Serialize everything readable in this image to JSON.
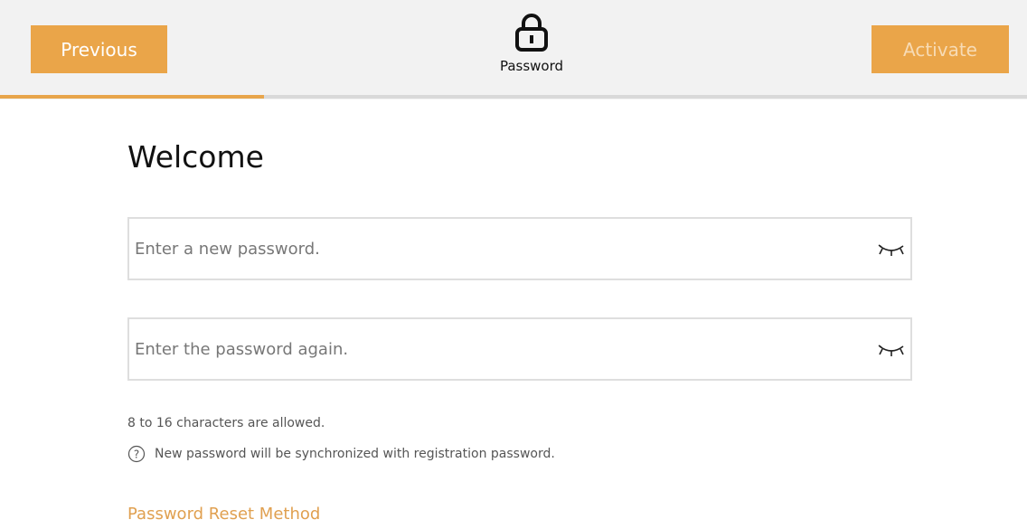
{
  "header": {
    "previous_label": "Previous",
    "activate_label": "Activate",
    "step_label": "Password",
    "step_icon": "lock-icon",
    "progress_fraction": 0.257
  },
  "main": {
    "title": "Welcome",
    "new_password": {
      "value": "",
      "placeholder": "Enter a new password.",
      "toggle_icon": "eye-closed-icon"
    },
    "confirm_password": {
      "value": "",
      "placeholder": "Enter the password again.",
      "toggle_icon": "eye-closed-icon"
    },
    "hint": "8 to 16 characters are allowed.",
    "note": "New password will be synchronized with registration password.",
    "note_icon": "question-circle-icon",
    "reset_link": "Password Reset Method"
  },
  "colors": {
    "accent": "#eaa549",
    "accent_disabled_text": "#f7dbb5",
    "link": "#e0a050",
    "header_bg": "#f2f2f2"
  }
}
